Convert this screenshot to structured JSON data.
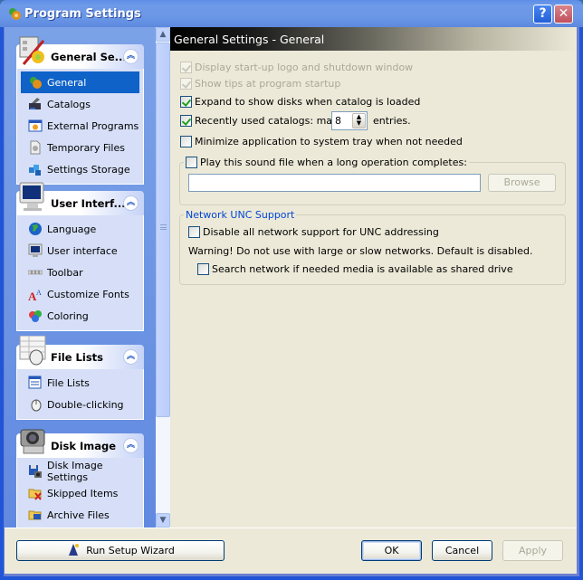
{
  "window": {
    "title": "Program Settings",
    "help_label": "?",
    "close_label": "✕"
  },
  "sidebar": {
    "groups": [
      {
        "title": "General Se...",
        "icon": "settings-tools-icon",
        "items": [
          {
            "label": "General",
            "icon": "general-gears-icon",
            "selected": true
          },
          {
            "label": "Catalogs",
            "icon": "scanner-icon"
          },
          {
            "label": "External Programs",
            "icon": "program-window-icon"
          },
          {
            "label": "Temporary Files",
            "icon": "temp-file-icon"
          },
          {
            "label": "Settings Storage",
            "icon": "storage-blocks-icon"
          }
        ]
      },
      {
        "title": "User Interf...",
        "icon": "monitor-icon",
        "items": [
          {
            "label": "Language",
            "icon": "globe-icon"
          },
          {
            "label": "User interface",
            "icon": "monitor-small-icon"
          },
          {
            "label": "Toolbar",
            "icon": "toolbar-icon"
          },
          {
            "label": "Customize Fonts",
            "icon": "font-icon"
          },
          {
            "label": "Coloring",
            "icon": "color-balls-icon"
          }
        ]
      },
      {
        "title": "File Lists",
        "icon": "file-list-mouse-icon",
        "items": [
          {
            "label": "File Lists",
            "icon": "file-list-icon"
          },
          {
            "label": "Double-clicking",
            "icon": "mouse-icon"
          }
        ]
      },
      {
        "title": "Disk Image",
        "icon": "camera-icon",
        "items": [
          {
            "label": "Disk Image Settings",
            "icon": "floppy-camera-icon"
          },
          {
            "label": "Skipped Items",
            "icon": "folder-x-icon"
          },
          {
            "label": "Archive Files",
            "icon": "folder-archive-icon"
          }
        ]
      }
    ]
  },
  "panel": {
    "header": "General Settings - General",
    "options": {
      "display_logo": {
        "label": "Display start-up logo and shutdown window",
        "checked": true,
        "disabled": true
      },
      "show_tips": {
        "label": "Show tips at program startup",
        "checked": true,
        "disabled": true
      },
      "expand_disks": {
        "label": "Expand to show disks when catalog is loaded",
        "checked": true
      },
      "recent_catalogs": {
        "label": "Recently used catalogs: max.",
        "checked": true,
        "value": "8",
        "suffix": "entries."
      },
      "minimize_tray": {
        "label": "Minimize application to system tray when not needed",
        "checked": false
      }
    },
    "sound": {
      "label": "Play this sound file when a long operation completes:",
      "checked": false,
      "path_value": "",
      "browse_label": "Browse"
    },
    "network": {
      "legend": "Network UNC Support",
      "legend_color": "#0046d5",
      "disable_unc": {
        "label": "Disable all network support for UNC addressing",
        "checked": false
      },
      "warning": "Warning! Do not use with large or slow networks. Default is disabled.",
      "search_network": {
        "label": "Search network if needed media is available as shared drive",
        "checked": false
      }
    }
  },
  "footer": {
    "wizard_label": "Run Setup Wizard",
    "ok_label": "OK",
    "cancel_label": "Cancel",
    "apply_label": "Apply"
  }
}
